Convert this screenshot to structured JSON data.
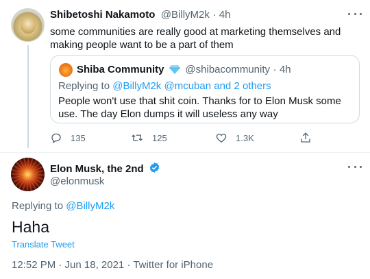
{
  "parent_tweet": {
    "author_name": "Shibetoshi Nakamoto",
    "author_handle": "@BillyM2k",
    "separator": "·",
    "time": "4h",
    "text": "some communities are really good at marketing themselves and making people want to be a part of them",
    "quoted": {
      "author_name": "Shiba Community",
      "author_handle": "@shibacommunity",
      "separator": "·",
      "time": "4h",
      "replying_to_prefix": "Replying to",
      "replying_to_1": "@BillyM2k",
      "replying_to_2": "@mcuban",
      "replying_to_rest": "and 2 others",
      "text": "People won't use that shit coin. Thanks for to Elon Musk some use. The day Elon dumps it will useless any way"
    },
    "actions": {
      "replies": "135",
      "retweets": "125",
      "likes": "1.3K"
    }
  },
  "main_tweet": {
    "author_name": "Elon Musk, the 2nd",
    "author_handle": "@elonmusk",
    "replying_to_prefix": "Replying to",
    "replying_to": "@BillyM2k",
    "text": "Haha",
    "translate_label": "Translate Tweet",
    "timestamp": "12:52 PM · Jun 18, 2021 · Twitter for iPhone"
  },
  "icons": {
    "reply": "reply-icon",
    "retweet": "retweet-icon",
    "like": "heart-icon",
    "share": "share-icon",
    "more": "more-icon",
    "verified": "verified-badge-icon"
  },
  "colors": {
    "link": "#1d9bf0",
    "secondary_text": "#536471",
    "border": "#cfd9de",
    "verified_badge": "#1d9bf0",
    "shiba_verified": "#5bc8f5"
  }
}
